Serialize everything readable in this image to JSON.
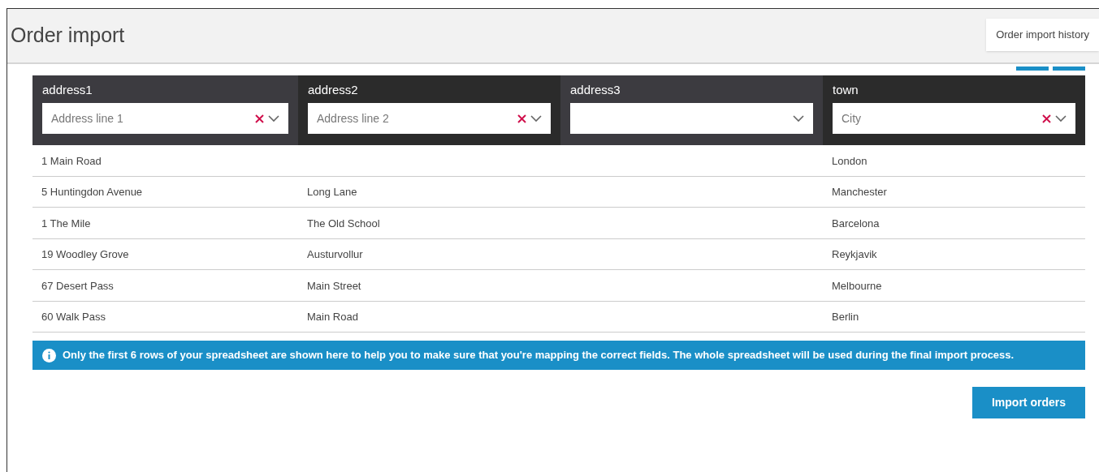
{
  "page": {
    "title": "Order import",
    "history_button": "Order import history"
  },
  "mapping": [
    {
      "label": "address1",
      "value": "Address line 1",
      "clearable": true
    },
    {
      "label": "address2",
      "value": "Address line 2",
      "clearable": true
    },
    {
      "label": "address3",
      "clearable": false
    },
    {
      "label": "town",
      "value": "City",
      "clearable": true
    }
  ],
  "rows": [
    [
      "1 Main Road",
      null,
      null,
      "London"
    ],
    [
      "5 Huntingdon Avenue",
      "Long Lane",
      null,
      "Manchester"
    ],
    [
      "1 The Mile",
      "The Old School",
      null,
      "Barcelona"
    ],
    [
      "19 Woodley Grove",
      "Austurvollur",
      null,
      "Reykjavik"
    ],
    [
      "67 Desert Pass",
      "Main Street",
      null,
      "Melbourne"
    ],
    [
      "60 Walk Pass",
      "Main Road",
      null,
      "Berlin"
    ]
  ],
  "notice": "Only the first 6 rows of your spreadsheet are shown here to help you to make sure that you're mapping the correct fields. The whole spreadsheet will be used during the final import process.",
  "import_button": "Import orders"
}
